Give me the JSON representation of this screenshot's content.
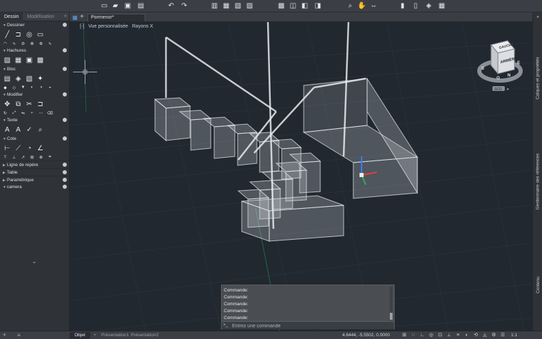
{
  "toolbar": {
    "buttons": [
      {
        "name": "new-file-icon",
        "glyph": "▭"
      },
      {
        "name": "open-file-icon",
        "glyph": "▰"
      },
      {
        "name": "save-icon",
        "glyph": "▣"
      },
      {
        "name": "save-as-icon",
        "glyph": "▤"
      },
      {
        "name": "undo-icon",
        "glyph": "↶"
      },
      {
        "name": "redo-icon",
        "glyph": "↷"
      },
      {
        "name": "plot-icon",
        "glyph": "▥"
      },
      {
        "name": "print-preview-icon",
        "glyph": "▦"
      },
      {
        "name": "publish-icon",
        "glyph": "▧"
      },
      {
        "name": "batch-plot-icon",
        "glyph": "▨"
      },
      {
        "name": "import-icon",
        "glyph": "▩"
      },
      {
        "name": "export-icon",
        "glyph": "◫"
      },
      {
        "name": "sheet-icon",
        "glyph": "◧"
      },
      {
        "name": "layout-icon",
        "glyph": "◨"
      },
      {
        "name": "zoom-icon",
        "glyph": "⌕"
      },
      {
        "name": "pan-icon",
        "glyph": "✋"
      },
      {
        "name": "orbit-icon",
        "glyph": "⇔"
      },
      {
        "name": "match-properties-icon",
        "glyph": "▮"
      },
      {
        "name": "properties-icon",
        "glyph": "▯"
      },
      {
        "name": "layers-icon",
        "glyph": "◈"
      },
      {
        "name": "quick-calc-icon",
        "glyph": "▦"
      }
    ]
  },
  "palette": {
    "tabs": [
      {
        "label": "Dessin",
        "active": true
      },
      {
        "label": "Modélisation",
        "active": false
      }
    ],
    "collapse_label": "«",
    "sections": [
      {
        "title": "Dessiner",
        "open": true,
        "rows": [
          [
            {
              "name": "line-tool-icon",
              "glyph": "╱"
            },
            {
              "name": "polyline-tool-icon",
              "glyph": "⊐"
            },
            {
              "name": "circle-tool-icon",
              "glyph": "◎"
            },
            {
              "name": "rectangle-tool-icon",
              "glyph": "▭"
            }
          ],
          [
            {
              "name": "arc-tool-icon",
              "glyph": "◠"
            },
            {
              "name": "spline-tool-icon",
              "glyph": "∿"
            },
            {
              "name": "hatch-tool-icon",
              "glyph": "⊘"
            },
            {
              "name": "region-tool-icon",
              "glyph": "⊗"
            },
            {
              "name": "ellipse-tool-icon",
              "glyph": "⊛"
            },
            {
              "name": "point-tool-icon",
              "glyph": "∿"
            }
          ]
        ]
      },
      {
        "title": "Hachures",
        "open": true,
        "rows": [
          [
            {
              "name": "hatch-icon",
              "glyph": "▨"
            },
            {
              "name": "gradient-icon",
              "glyph": "▦"
            },
            {
              "name": "boundary-icon",
              "glyph": "▣"
            },
            {
              "name": "wipeout-icon",
              "glyph": "▩"
            }
          ]
        ]
      },
      {
        "title": "Bloc",
        "open": true,
        "rows": [
          [
            {
              "name": "insert-block-icon",
              "glyph": "▤"
            },
            {
              "name": "create-block-icon",
              "glyph": "◈"
            },
            {
              "name": "edit-block-icon",
              "glyph": "▧"
            },
            {
              "name": "block-attribute-icon",
              "glyph": "✦"
            }
          ],
          [
            {
              "name": "attribute-icon",
              "glyph": "◆"
            },
            {
              "name": "attribute-edit-icon",
              "glyph": "◇"
            },
            {
              "name": "attribute-sync-icon",
              "glyph": "▼"
            },
            {
              "name": "attribute-manager-icon",
              "glyph": "◐"
            },
            {
              "name": "block-editor-icon",
              "glyph": "◑"
            },
            {
              "name": "block-save-icon",
              "glyph": "◒"
            }
          ]
        ]
      },
      {
        "title": "Modifier",
        "open": true,
        "rows": [
          [
            {
              "name": "move-icon",
              "glyph": "✥"
            },
            {
              "name": "copy-icon",
              "glyph": "⧉"
            },
            {
              "name": "trim-icon",
              "glyph": "✂"
            },
            {
              "name": "offset-icon",
              "glyph": "⊐"
            }
          ],
          [
            {
              "name": "rotate-icon",
              "glyph": "↻"
            },
            {
              "name": "scale-icon",
              "glyph": "⤢"
            },
            {
              "name": "mirror-icon",
              "glyph": "⇋"
            },
            {
              "name": "fillet-icon",
              "glyph": "⌐"
            },
            {
              "name": "array-icon",
              "glyph": "⋯"
            },
            {
              "name": "erase-icon",
              "glyph": "⌫"
            }
          ]
        ]
      },
      {
        "title": "Texte",
        "open": true,
        "rows": [
          [
            {
              "name": "multiline-text-icon",
              "glyph": "A"
            },
            {
              "name": "single-line-text-icon",
              "glyph": "A"
            },
            {
              "name": "spell-check-icon",
              "glyph": "✓"
            },
            {
              "name": "find-text-icon",
              "glyph": "⌕"
            }
          ]
        ]
      },
      {
        "title": "Cote",
        "open": true,
        "rows": [
          [
            {
              "name": "linear-dimension-icon",
              "glyph": "⊢"
            },
            {
              "name": "aligned-dimension-icon",
              "glyph": "⟋"
            },
            {
              "name": "radius-dimension-icon",
              "glyph": "◔"
            },
            {
              "name": "angular-dimension-icon",
              "glyph": "∠"
            }
          ],
          [
            {
              "name": "baseline-dimension-icon",
              "glyph": "⊤"
            },
            {
              "name": "continue-dimension-icon",
              "glyph": "⊥"
            },
            {
              "name": "leader-icon",
              "glyph": "↗"
            },
            {
              "name": "tolerance-icon",
              "glyph": "⊞"
            },
            {
              "name": "center-mark-icon",
              "glyph": "⊕"
            },
            {
              "name": "dim-style-icon",
              "glyph": "⌗"
            }
          ]
        ]
      },
      {
        "title": "Ligne de repère",
        "open": false,
        "rows": []
      },
      {
        "title": "Table",
        "open": false,
        "rows": []
      },
      {
        "title": "Paramétrique",
        "open": false,
        "rows": []
      },
      {
        "title": "camera",
        "open": true,
        "rows": []
      }
    ],
    "more_label": "⌄"
  },
  "doc_tabs": {
    "active_tab": "Pormenor*",
    "plus_label": "+"
  },
  "viewport": {
    "view_label": "Vue personnalisée",
    "visual_style": "Rayons X",
    "control_label": "[-]"
  },
  "navcube": {
    "face_label": "ARRIÈRE",
    "top_label": "GAUCHE",
    "compass": [
      "S",
      "O",
      "N",
      "E"
    ],
    "wcs_label": "SCG"
  },
  "right_panel": {
    "tabs": [
      "Calques et propriétés",
      "Gestionnaire des références",
      "Contenu"
    ],
    "collapse_label": "«"
  },
  "command": {
    "history": [
      "Commande:",
      "Commande:",
      "Commande:",
      "Commande:",
      "Commande:",
      "Commande:"
    ],
    "prompt_icon": ">_",
    "placeholder": "Entrez une commande"
  },
  "status": {
    "tabs": [
      "Objet",
      "Présentation1",
      "Présentation2"
    ],
    "plus": "+",
    "coordinates": "4.6444, -5.5502, 0.0000",
    "scale": "1:1",
    "icons": [
      "grid-icon",
      "snap-icon",
      "ortho-icon",
      "polar-icon",
      "osnap-icon",
      "otrack-icon",
      "lineweight-icon",
      "transparency-icon",
      "selection-cycling-icon",
      "annotation-icon",
      "workspace-icon",
      "settings-icon"
    ]
  }
}
